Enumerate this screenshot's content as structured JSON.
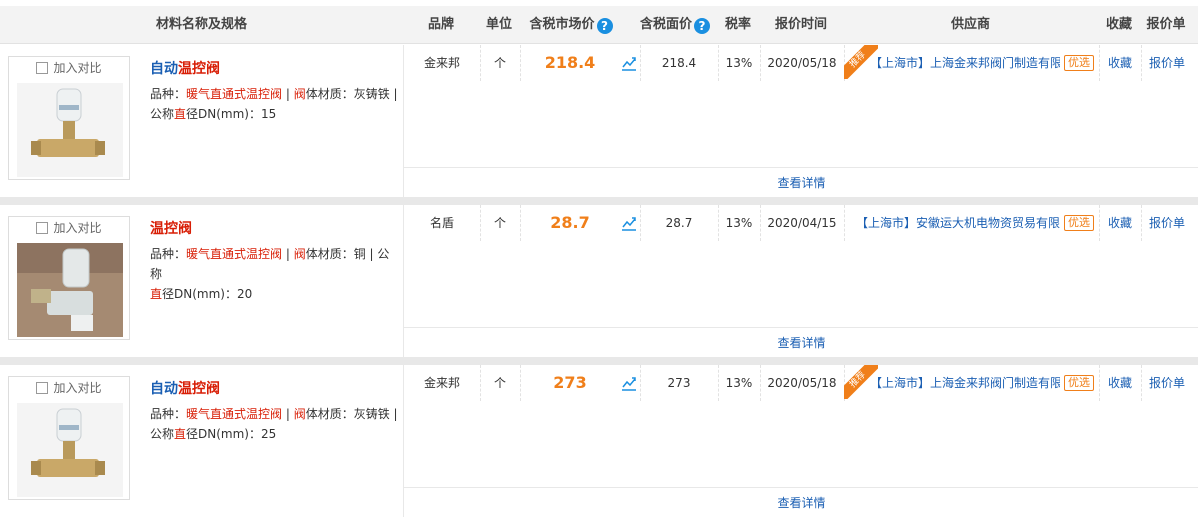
{
  "header": {
    "name_spec": "材料名称及规格",
    "brand": "品牌",
    "unit": "单位",
    "market_price": "含税市场价",
    "face_price": "含税面价",
    "tax_rate": "税率",
    "quote_time": "报价时间",
    "supplier": "供应商",
    "favorite": "收藏",
    "quote_sheet": "报价单",
    "help_glyph": "?"
  },
  "colors": {
    "accent_orange": "#f07f1a",
    "link_blue": "#1b5fb3",
    "highlight_red": "#d81e06",
    "help_blue": "#1a8fe0"
  },
  "icons": {
    "trend": "trend-chart-icon",
    "help": "help-icon",
    "checkbox": "checkbox-icon"
  },
  "rows": [
    {
      "compare_label": "加入对比",
      "name_part1": "自动",
      "name_part2": "温控阀",
      "spec_line1_a": "品种：",
      "spec_line1_b": "暖气直通式温控阀",
      "spec_line1_c": " | ",
      "spec_line1_d": "阀",
      "spec_line1_e": "体材质：灰铸铁 |",
      "spec_line2_a": "公称",
      "spec_line2_b": "直",
      "spec_line2_c": "径DN(mm)：15",
      "brand": "金来邦",
      "unit": "个",
      "market_price": "218.4",
      "face_price": "218.4",
      "tax_rate": "13%",
      "quote_date": "2020/05/18",
      "recommended_label": "推荐",
      "supplier": "【上海市】上海金来邦阀门制造有限公...",
      "badge": "优选",
      "favorite": "收藏",
      "quote_sheet": "报价单",
      "detail": "查看详情"
    },
    {
      "compare_label": "加入对比",
      "name_part1": "",
      "name_part2": "温控阀",
      "spec_line1_a": "品种：",
      "spec_line1_b": "暖气直通式温控阀",
      "spec_line1_c": " | ",
      "spec_line1_d": "阀",
      "spec_line1_e": "体材质：铜 | 公称",
      "spec_line2_a": "",
      "spec_line2_b": "直",
      "spec_line2_c": "径DN(mm)：20",
      "brand": "名盾",
      "unit": "个",
      "market_price": "28.7",
      "face_price": "28.7",
      "tax_rate": "13%",
      "quote_date": "2020/04/15",
      "recommended_label": "",
      "supplier": "【上海市】安徽运大机电物资贸易有限...",
      "badge": "优选",
      "favorite": "收藏",
      "quote_sheet": "报价单",
      "detail": "查看详情"
    },
    {
      "compare_label": "加入对比",
      "name_part1": "自动",
      "name_part2": "温控阀",
      "spec_line1_a": "品种：",
      "spec_line1_b": "暖气直通式温控阀",
      "spec_line1_c": " | ",
      "spec_line1_d": "阀",
      "spec_line1_e": "体材质：灰铸铁 |",
      "spec_line2_a": "公称",
      "spec_line2_b": "直",
      "spec_line2_c": "径DN(mm)：25",
      "brand": "金来邦",
      "unit": "个",
      "market_price": "273",
      "face_price": "273",
      "tax_rate": "13%",
      "quote_date": "2020/05/18",
      "recommended_label": "推荐",
      "supplier": "【上海市】上海金来邦阀门制造有限公...",
      "badge": "优选",
      "favorite": "收藏",
      "quote_sheet": "报价单",
      "detail": "查看详情"
    }
  ]
}
